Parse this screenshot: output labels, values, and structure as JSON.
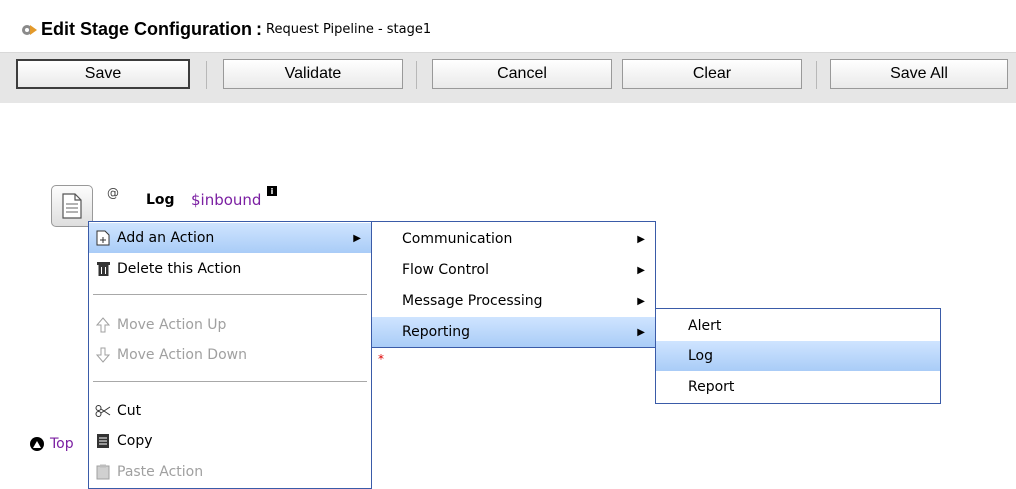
{
  "header": {
    "title": "Edit Stage Configuration",
    "separator": ":",
    "subtitle": "Request Pipeline - stage1"
  },
  "toolbar": {
    "buttons": [
      {
        "label": "Save"
      },
      {
        "label": "Validate"
      },
      {
        "label": "Cancel"
      },
      {
        "label": "Clear"
      },
      {
        "label": "Save All"
      }
    ]
  },
  "stage": {
    "at_symbol": "@",
    "action_label": "Log",
    "variable": "$inbound",
    "info_badge": "i",
    "required_mark": "*",
    "top_link": "Top"
  },
  "context_menu": {
    "items": [
      {
        "label": "Add an Action",
        "icon": "add-action-icon",
        "has_submenu": true,
        "state": "highlighted"
      },
      {
        "label": "Delete this Action",
        "icon": "trash-icon",
        "state": "enabled"
      },
      {
        "label": "Move Action Up",
        "icon": "arrow-up-icon",
        "state": "disabled"
      },
      {
        "label": "Move Action Down",
        "icon": "arrow-down-icon",
        "state": "disabled"
      },
      {
        "label": "Cut",
        "icon": "scissors-icon",
        "state": "enabled"
      },
      {
        "label": "Copy",
        "icon": "copy-icon",
        "state": "enabled"
      },
      {
        "label": "Paste Action",
        "icon": "paste-icon",
        "state": "disabled"
      }
    ]
  },
  "action_submenu": {
    "items": [
      {
        "label": "Communication",
        "has_submenu": true
      },
      {
        "label": "Flow Control",
        "has_submenu": true
      },
      {
        "label": "Message Processing",
        "has_submenu": true
      },
      {
        "label": "Reporting",
        "has_submenu": true,
        "state": "highlighted"
      }
    ]
  },
  "reporting_submenu": {
    "items": [
      {
        "label": "Alert"
      },
      {
        "label": "Log",
        "state": "highlighted"
      },
      {
        "label": "Report"
      }
    ]
  },
  "colors": {
    "highlight": "#a9ccf7",
    "menu_border": "#3a5ba8",
    "variable_text": "#7b1fa2",
    "disabled_text": "#a0a0a0"
  }
}
